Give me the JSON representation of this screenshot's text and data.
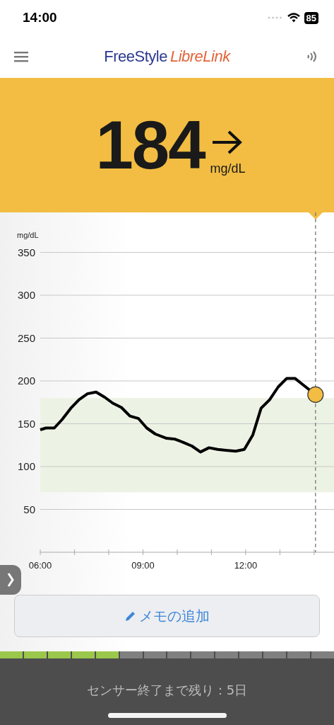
{
  "status_bar": {
    "time": "14:00",
    "battery": "85"
  },
  "header": {
    "logo_first": "FreeStyle",
    "logo_second": "LibreLink"
  },
  "reading": {
    "value": "184",
    "unit": "mg/dL"
  },
  "chart_data": {
    "type": "line",
    "ylabel": "mg/dL",
    "xlim": [
      6,
      14.58
    ],
    "ylim": [
      0,
      350
    ],
    "yticks": [
      50,
      100,
      150,
      200,
      250,
      300,
      350
    ],
    "xticks": [
      {
        "value": 6,
        "label": "06:00"
      },
      {
        "value": 9,
        "label": "09:00"
      },
      {
        "value": 12,
        "label": "12:00"
      }
    ],
    "x": [
      6.0,
      6.17,
      6.41,
      6.64,
      6.89,
      7.13,
      7.38,
      7.63,
      7.88,
      8.12,
      8.37,
      8.62,
      8.87,
      9.11,
      9.36,
      9.69,
      9.94,
      10.19,
      10.43,
      10.68,
      10.93,
      11.18,
      11.42,
      11.71,
      11.96,
      12.21,
      12.45,
      12.7,
      12.95,
      13.2,
      13.44,
      13.69,
      14.04
    ],
    "grid": true,
    "series": [
      {
        "color": "#000000",
        "values": [
          143,
          145,
          145,
          155,
          168,
          178,
          185,
          187,
          181,
          174,
          169,
          159,
          156,
          145,
          138,
          133,
          132,
          128,
          124,
          117,
          122,
          120,
          119,
          118,
          120,
          137,
          168,
          178,
          193,
          203,
          203,
          195,
          184
        ]
      }
    ],
    "bands": [
      {
        "axis": "y",
        "from": 70,
        "to": 180
      }
    ],
    "ref_lines": [
      {
        "axis": "x",
        "value": 14.04
      }
    ]
  },
  "memo_button": {
    "label": "メモの追加"
  },
  "sensor": {
    "segments": [
      {
        "on": true
      },
      {
        "on": true
      },
      {
        "on": true
      },
      {
        "on": true
      },
      {
        "on": true
      },
      {
        "on": false
      },
      {
        "on": false
      },
      {
        "on": false
      },
      {
        "on": false
      },
      {
        "on": false
      },
      {
        "on": false
      },
      {
        "on": false
      },
      {
        "on": false
      },
      {
        "on": false
      }
    ],
    "remaining": "センサー終了まで残り：5日"
  }
}
